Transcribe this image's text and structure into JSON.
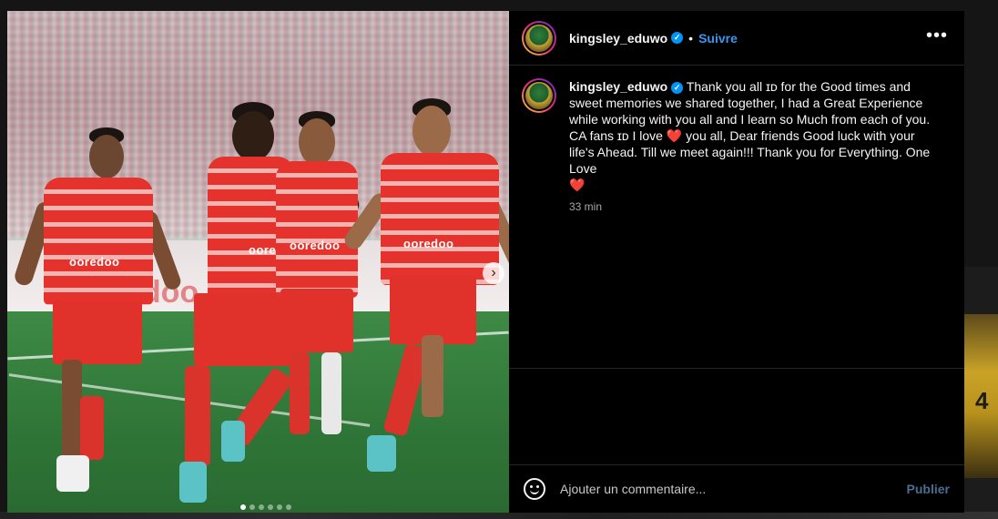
{
  "post": {
    "image_sponsor_text": "ooredoo",
    "board_text": "oredoo",
    "carousel": {
      "dot_count": 6,
      "active_index": 0,
      "next_icon": "chevron-right-icon"
    }
  },
  "header": {
    "username": "kingsley_eduwo",
    "separator": "•",
    "follow_label": "Suivre",
    "more_icon": "more-horizontal-icon",
    "more_label": "•••"
  },
  "caption": {
    "username": "kingsley_eduwo",
    "text_part1": "Thank you all ɪᴅ for the Good times and sweet memories we shared together, I had a Great Experience while working with you all and I learn so Much from each of you. CA fans ɪᴅ I love ",
    "heart1": "❤️",
    "text_part2": " you all, Dear friends Good luck with your life's Ahead. Till we meet again!!! Thank you for Everything. One Love ",
    "heart2": "❤️",
    "time": "33 min"
  },
  "comment": {
    "emoji_icon": "emoji-smile-icon",
    "placeholder": "Ajouter un commentaire...",
    "publish_label": "Publier"
  },
  "colors": {
    "accent_blue": "#3797f0",
    "verified_blue": "#0095f6",
    "heart_red": "#ed1c3a",
    "panel_bg": "#000000"
  }
}
